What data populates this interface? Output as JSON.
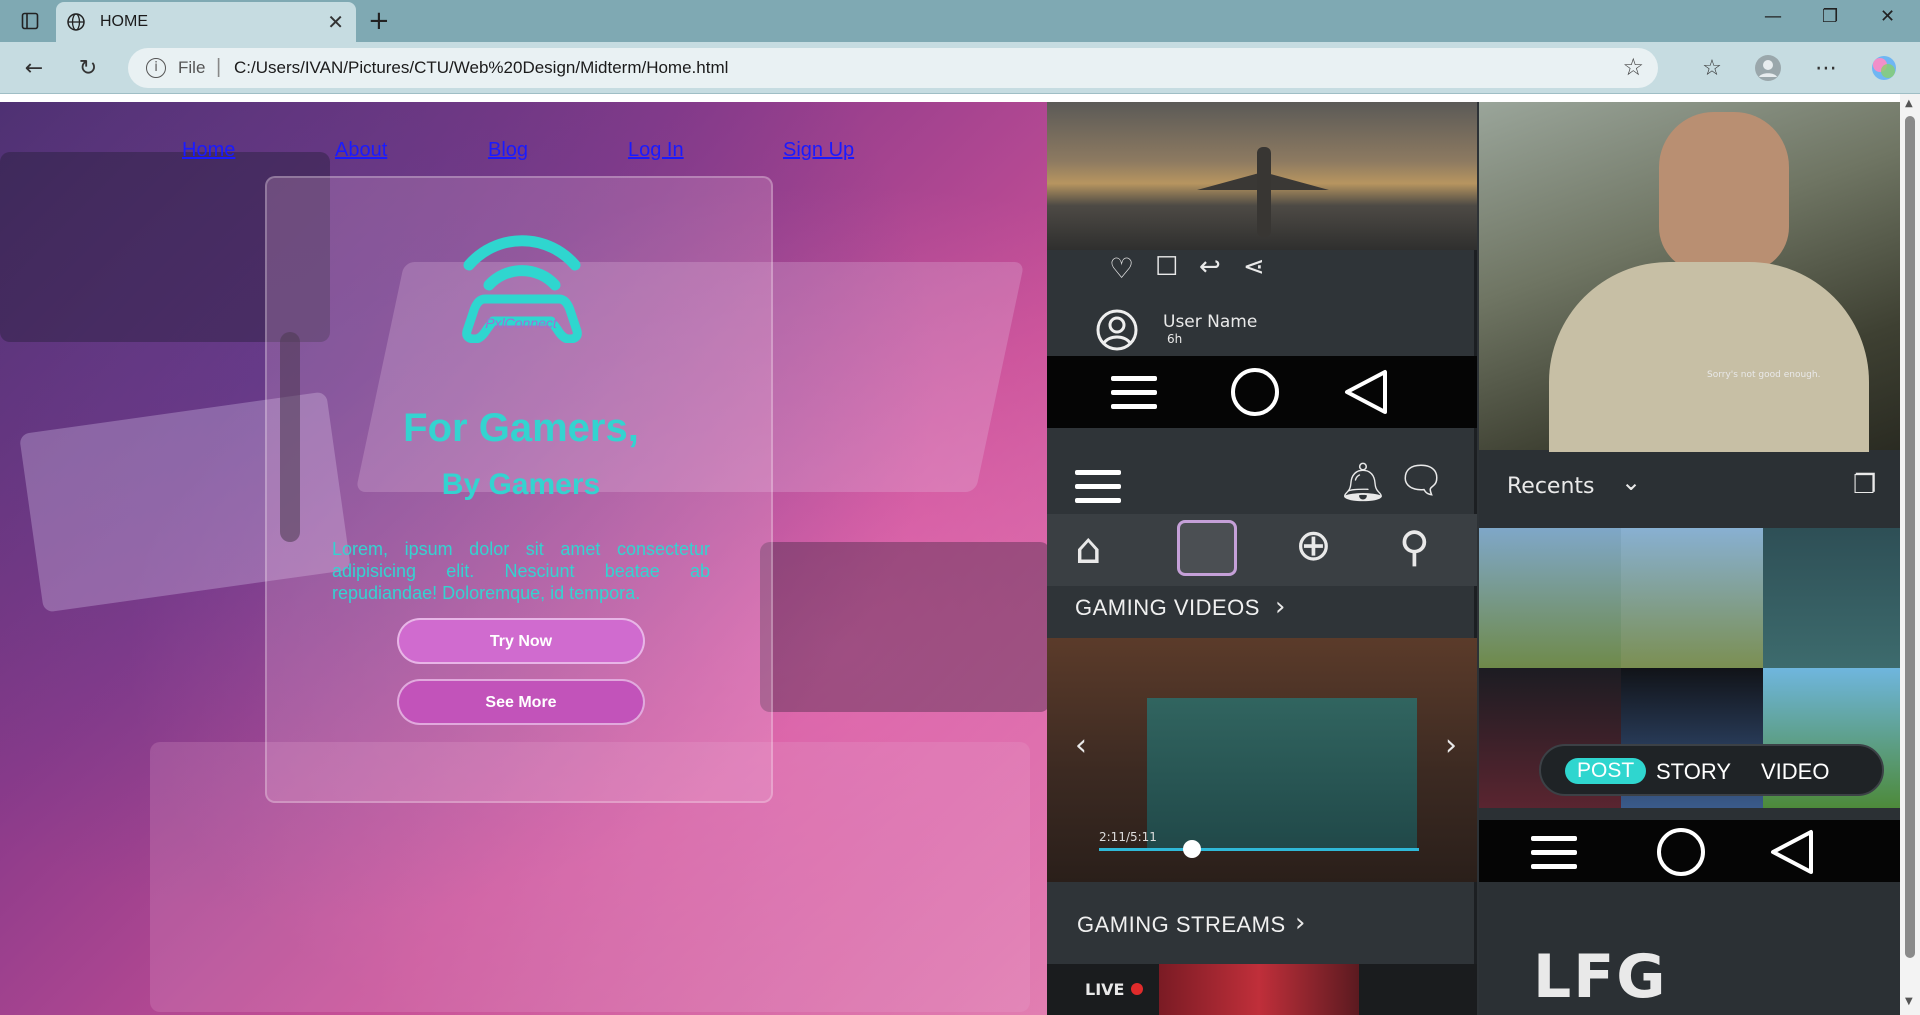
{
  "browser": {
    "tab_title": "HOME",
    "new_tab": "+",
    "close_tab": "✕",
    "url_scheme": "File",
    "url": "C:/Users/IVAN/Pictures/CTU/Web%20Design/Midterm/Home.html",
    "window_controls": {
      "minimize": "—",
      "maximize": "❐",
      "close": "✕"
    }
  },
  "nav": {
    "items": [
      {
        "label": "Home"
      },
      {
        "label": "About"
      },
      {
        "label": "Blog"
      },
      {
        "label": "Log In"
      },
      {
        "label": "Sign Up"
      }
    ]
  },
  "hero": {
    "logo_text": "PxlConnect",
    "title": "For Gamers,",
    "subtitle": "By Gamers",
    "body": "Lorem, ipsum dolor sit amet consectetur adipisicing elit. Nesciunt beatae ab repudiandae! Doloremque, id tempora.",
    "primary_button": "Try Now",
    "secondary_button": "See More"
  },
  "mockup": {
    "post": {
      "user_name": "User Name",
      "time": "6h"
    },
    "section_videos": "GAMING VIDEOS",
    "section_streams": "GAMING STREAMS",
    "video_time": "2:11/5:11",
    "live_label": "LIVE",
    "recents_label": "Recents",
    "caption_small": "Sorry's not good enough.",
    "segment": {
      "post": "POST",
      "story": "STORY",
      "video": "VIDEO"
    },
    "lfg_label": "LFG",
    "accent_color": "#2fd6cf"
  }
}
